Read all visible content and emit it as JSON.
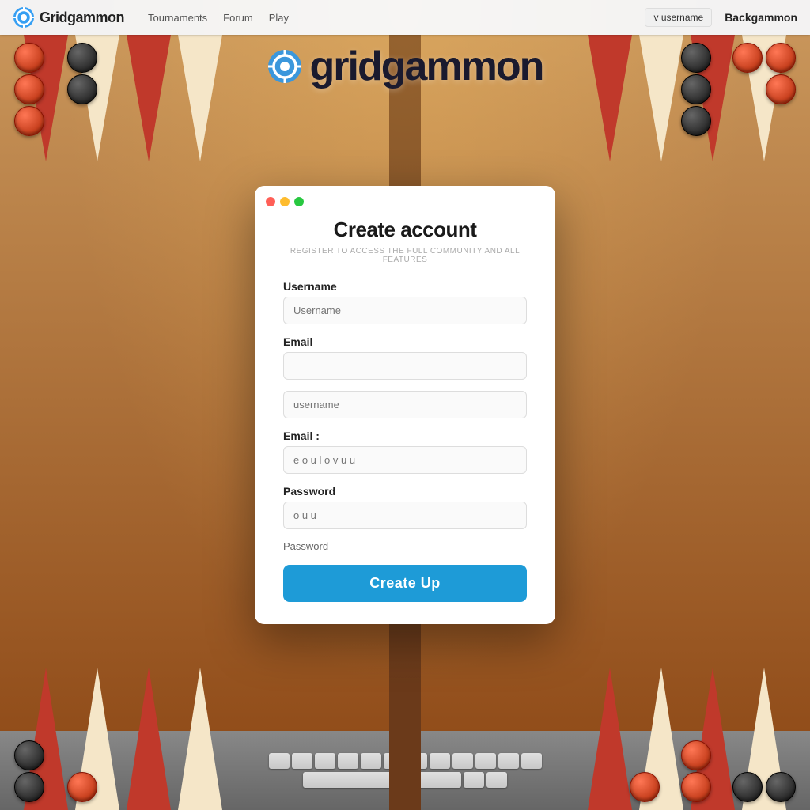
{
  "navbar": {
    "brand": "Gridgammon",
    "links": [
      "Tournaments",
      "Forum",
      "Play"
    ],
    "right_btn": "v username",
    "active_page": "Backgammon"
  },
  "hero": {
    "title": "gridgammon"
  },
  "modal": {
    "title": "Create account",
    "subtitle": "REGISTER TO ACCESS THE FULL COMMUNITY AND ALL FEATURES",
    "fields": [
      {
        "label": "Username",
        "placeholder": "Username",
        "type": "text",
        "value": ""
      },
      {
        "label": "Email",
        "placeholder": "",
        "type": "email",
        "value": ""
      },
      {
        "label": "",
        "placeholder": "username",
        "type": "text",
        "value": ""
      },
      {
        "label": "Email :",
        "placeholder": "e o u l o v u u",
        "type": "email",
        "value": ""
      },
      {
        "label": "Password",
        "placeholder": "o u u",
        "type": "password",
        "value": ""
      }
    ],
    "below_password": "Password",
    "submit_label": "Create Up"
  }
}
